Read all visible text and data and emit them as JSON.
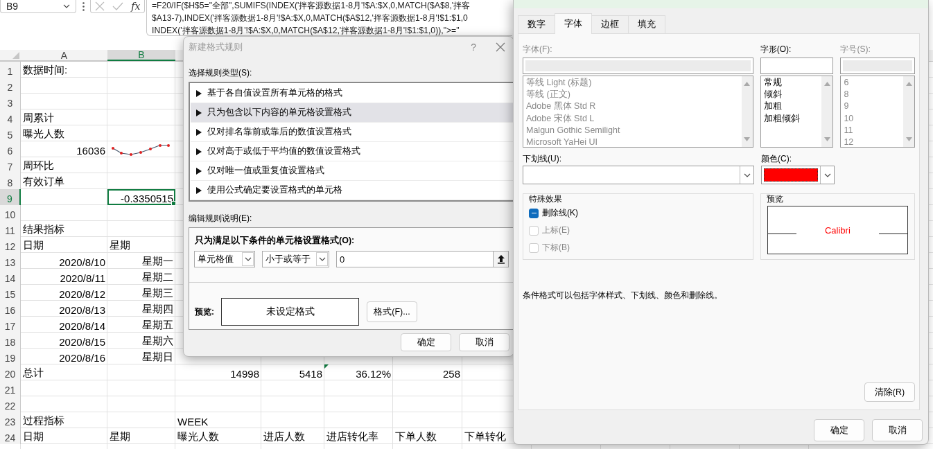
{
  "formula_bar": {
    "name_box": "B9",
    "function_label": "fx",
    "formula_lines": [
      "=F20/IF($H$5=\"全部\",SUMIFS(INDEX('拌客源数据1-8月'!$A:$X,0,MATCH($A$8,'拌客",
      "$A13-7),INDEX('拌客源数据1-8月'!$A:$X,0,MATCH($A$12,'拌客源数据1-8月'!$1:$1,0",
      "INDEX('拌客源数据1-8月'!$A:$X,0,MATCH($A$12,'拌客源数据1-8月'!$1:$1,0)),\">=\""
    ]
  },
  "sheet": {
    "columns": [
      {
        "label": "A",
        "selected": false
      },
      {
        "label": "B",
        "selected": true
      }
    ],
    "rows": [
      {
        "number": "1",
        "cells": {
          "A": {
            "kind": "label",
            "text": "数据时间:",
            "selected": false
          }
        }
      },
      {
        "number": "2"
      },
      {
        "number": "3"
      },
      {
        "number": "4",
        "cells": {
          "A": {
            "kind": "label",
            "text": "周累计",
            "selected": false
          }
        }
      },
      {
        "number": "5",
        "cells": {
          "A": {
            "kind": "label",
            "text": "曝光人数",
            "selected": false
          }
        }
      },
      {
        "number": "6",
        "cells": {
          "A": {
            "kind": "value",
            "text": "16036",
            "selected": false
          },
          "B": {
            "kind": "sparkline",
            "selected": false
          }
        }
      },
      {
        "number": "7",
        "cells": {
          "A": {
            "kind": "label",
            "text": "周环比",
            "selected": false
          }
        }
      },
      {
        "number": "8",
        "cells": {
          "A": {
            "kind": "label",
            "text": "有效订单",
            "selected": false
          }
        }
      },
      {
        "number": "9",
        "cells": {
          "B": {
            "kind": "value",
            "text": "-0.3350515",
            "selected": true
          }
        }
      },
      {
        "number": "10"
      },
      {
        "number": "11",
        "cells": {
          "A": {
            "kind": "label",
            "text": "结果指标",
            "selected": false
          }
        }
      },
      {
        "number": "12",
        "cells": {
          "A": {
            "kind": "label",
            "text": "日期",
            "selected": false
          },
          "B": {
            "kind": "label",
            "text": "星期",
            "selected": false
          }
        }
      },
      {
        "number": "13",
        "cells": {
          "A": {
            "kind": "value",
            "text": "2020/8/10",
            "selected": false
          },
          "B": {
            "kind": "value",
            "text": "星期一",
            "selected": false
          }
        }
      },
      {
        "number": "14",
        "cells": {
          "A": {
            "kind": "value",
            "text": "2020/8/11",
            "selected": false
          },
          "B": {
            "kind": "value",
            "text": "星期二",
            "selected": false
          }
        }
      },
      {
        "number": "15",
        "cells": {
          "A": {
            "kind": "value",
            "text": "2020/8/12",
            "selected": false
          },
          "B": {
            "kind": "value",
            "text": "星期三",
            "selected": false
          }
        }
      },
      {
        "number": "16",
        "cells": {
          "A": {
            "kind": "value",
            "text": "2020/8/13",
            "selected": false
          },
          "B": {
            "kind": "value",
            "text": "星期四",
            "selected": false
          }
        }
      },
      {
        "number": "17",
        "cells": {
          "A": {
            "kind": "value",
            "text": "2020/8/14",
            "selected": false
          },
          "B": {
            "kind": "value",
            "text": "星期五",
            "selected": false
          }
        }
      },
      {
        "number": "18",
        "cells": {
          "A": {
            "kind": "value",
            "text": "2020/8/15",
            "selected": false
          },
          "B": {
            "kind": "value",
            "text": "星期六",
            "selected": false
          }
        }
      },
      {
        "number": "19",
        "cells": {
          "A": {
            "kind": "value",
            "text": "2020/8/16",
            "selected": false
          },
          "B": {
            "kind": "value",
            "text": "星期日",
            "selected": false
          }
        }
      },
      {
        "number": "20",
        "cells": {
          "A": {
            "kind": "label",
            "text": "总计",
            "selected": false
          },
          "C": {
            "kind": "value",
            "text": "14998",
            "selected": false
          },
          "D": {
            "kind": "value",
            "text": "5418",
            "selected": false
          },
          "E": {
            "kind": "value",
            "text": "36.12%",
            "selected": false,
            "error_flag": true
          },
          "F": {
            "kind": "value",
            "text": "258",
            "selected": false
          }
        }
      },
      {
        "number": "21"
      },
      {
        "number": "22"
      },
      {
        "number": "23",
        "cells": {
          "A": {
            "kind": "label",
            "text": "过程指标",
            "selected": false
          },
          "C": {
            "kind": "label",
            "text": "WEEK",
            "selected": false
          }
        }
      },
      {
        "number": "24",
        "cells": {
          "A": {
            "kind": "label",
            "text": "日期",
            "selected": false
          },
          "B": {
            "kind": "label",
            "text": "星期",
            "selected": false
          },
          "C": {
            "kind": "label",
            "text": "曝光人数",
            "selected": false
          },
          "D": {
            "kind": "label",
            "text": "进店人数",
            "selected": false
          },
          "E": {
            "kind": "label",
            "text": "进店转化率",
            "selected": false
          },
          "F": {
            "kind": "label",
            "text": "下单人数",
            "selected": false
          },
          "G": {
            "kind": "label",
            "text": "下单转化",
            "selected": false
          }
        }
      }
    ]
  },
  "rule_dialog": {
    "title": "新建格式规则",
    "help": "?",
    "type_label": "选择规则类型(S):",
    "rule_types": [
      {
        "label": "基于各自值设置所有单元格的格式",
        "selected": false
      },
      {
        "label": "只为包含以下内容的单元格设置格式",
        "selected": true
      },
      {
        "label": "仅对排名靠前或靠后的数值设置格式",
        "selected": false
      },
      {
        "label": "仅对高于或低于平均值的数值设置格式",
        "selected": false
      },
      {
        "label": "仅对唯一值或重复值设置格式",
        "selected": false
      },
      {
        "label": "使用公式确定要设置格式的单元格",
        "selected": false
      }
    ],
    "description_label": "编辑规则说明(E):",
    "condition_title": "只为满足以下条件的单元格设置格式(O):",
    "condition": {
      "field": "单元格值",
      "operator": "小于或等于",
      "value": "0"
    },
    "preview_label": "预览:",
    "preview_text": "未设定格式",
    "format_button": "格式(F)...",
    "buttons": [
      "确定",
      "取消"
    ]
  },
  "font_dialog": {
    "tabs": [
      {
        "label": "数字",
        "selected": false
      },
      {
        "label": "字体",
        "selected": true
      },
      {
        "label": "边框",
        "selected": false
      },
      {
        "label": "填充",
        "selected": false
      }
    ],
    "font": {
      "label": "字体(F):",
      "disabled": true,
      "items": [
        "等线 Light (标题)",
        "等线 (正文)",
        "Adobe 黑体 Std R",
        "Adobe 宋体 Std L",
        "Malgun Gothic Semilight",
        "Microsoft YaHei UI"
      ]
    },
    "style": {
      "label": "字形(O):",
      "disabled": false,
      "items": [
        "常规",
        "倾斜",
        "加粗",
        "加粗倾斜"
      ]
    },
    "size": {
      "label": "字号(S):",
      "disabled": true,
      "items": [
        "6",
        "8",
        "9",
        "10",
        "11",
        "12"
      ]
    },
    "underline": {
      "label": "下划线(U):"
    },
    "color": {
      "label": "颜色(C):",
      "color": "#ff0000"
    },
    "effects": {
      "title": "特殊效果",
      "options": [
        {
          "label": "删除线(K)",
          "indeterminate": true,
          "disabled": false
        },
        {
          "label": "上标(E)",
          "indeterminate": false,
          "disabled": true
        },
        {
          "label": "下标(B)",
          "indeterminate": false,
          "disabled": true
        }
      ]
    },
    "preview": {
      "title": "预览",
      "sample": "Calibri"
    },
    "note": "条件格式可以包括字体样式、下划线、颜色和删除线。",
    "clear_button": "清除(R)",
    "buttons": [
      "确定",
      "取消"
    ]
  }
}
